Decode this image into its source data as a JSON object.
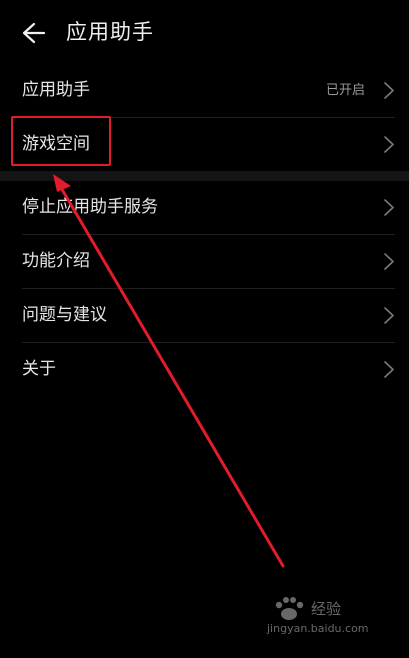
{
  "header": {
    "title": "应用助手",
    "back_icon": "back-arrow-icon"
  },
  "list": {
    "items": [
      {
        "label": "应用助手",
        "status": "已开启"
      },
      {
        "label": "游戏空间"
      },
      {
        "label": "停止应用助手服务"
      },
      {
        "label": "功能介绍"
      },
      {
        "label": "问题与建议"
      },
      {
        "label": "关于"
      }
    ]
  },
  "annotation": {
    "highlight_color": "#e21c2a"
  },
  "watermark": {
    "brand": "经验",
    "url": "jingyan.baidu.com"
  }
}
